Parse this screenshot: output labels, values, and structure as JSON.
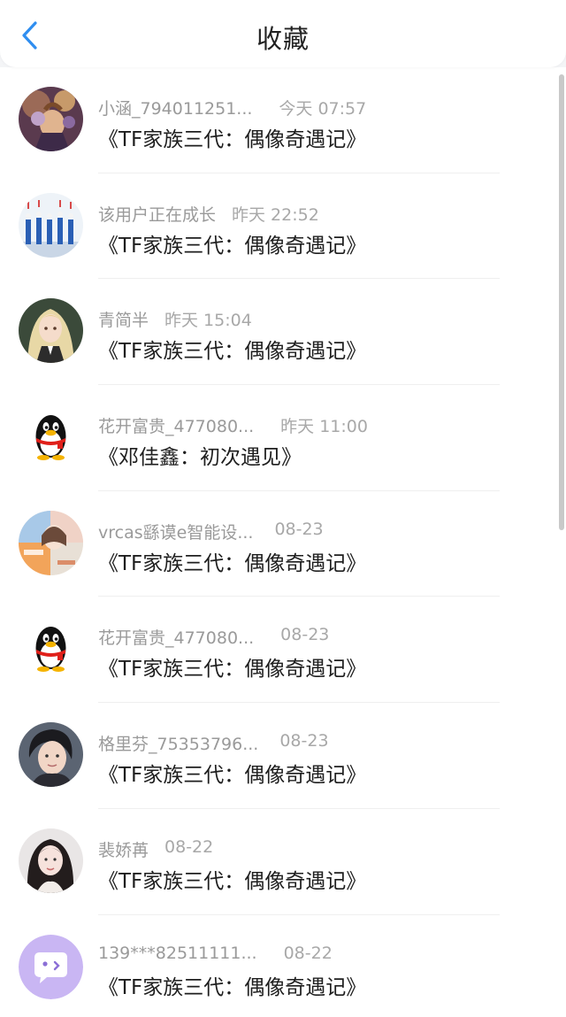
{
  "header": {
    "title": "收藏",
    "back_icon": "chevron-left-icon"
  },
  "colors": {
    "accent": "#2f8ef0",
    "bot_avatar": "#c9b6f3"
  },
  "items": [
    {
      "name": "小涵_794011251...",
      "time": "今天 07:57",
      "work": "《TF家族三代：偶像奇遇记》",
      "avatar": "game-character-avatar"
    },
    {
      "name": "该用户正在成长",
      "time": "昨天 22:52",
      "work": "《TF家族三代：偶像奇遇记》",
      "avatar": "dancers-avatar"
    },
    {
      "name": "青简半",
      "time": "昨天 15:04",
      "work": "《TF家族三代：偶像奇遇记》",
      "avatar": "anime-girl-avatar"
    },
    {
      "name": "花开富贵_477080...",
      "time": "昨天 11:00",
      "work": "《邓佳鑫：初次遇见》",
      "avatar": "penguin-avatar"
    },
    {
      "name": "vrcas繇谟e智能设...",
      "time": "08-23",
      "work": "《TF家族三代：偶像奇遇记》",
      "avatar": "collage-avatar"
    },
    {
      "name": "花开富贵_477080...",
      "time": "08-23",
      "work": "《TF家族三代：偶像奇遇记》",
      "avatar": "penguin-avatar"
    },
    {
      "name": "格里芬_75353796...",
      "time": "08-23",
      "work": "《TF家族三代：偶像奇遇记》",
      "avatar": "person-photo-avatar"
    },
    {
      "name": "裴娇苒",
      "time": "08-22",
      "work": "《TF家族三代：偶像奇遇记》",
      "avatar": "girl-photo-avatar"
    },
    {
      "name": "139***82511111...",
      "time": "08-22",
      "work": "《TF家族三代：偶像奇遇记》",
      "avatar": "chat-bot-avatar"
    }
  ]
}
